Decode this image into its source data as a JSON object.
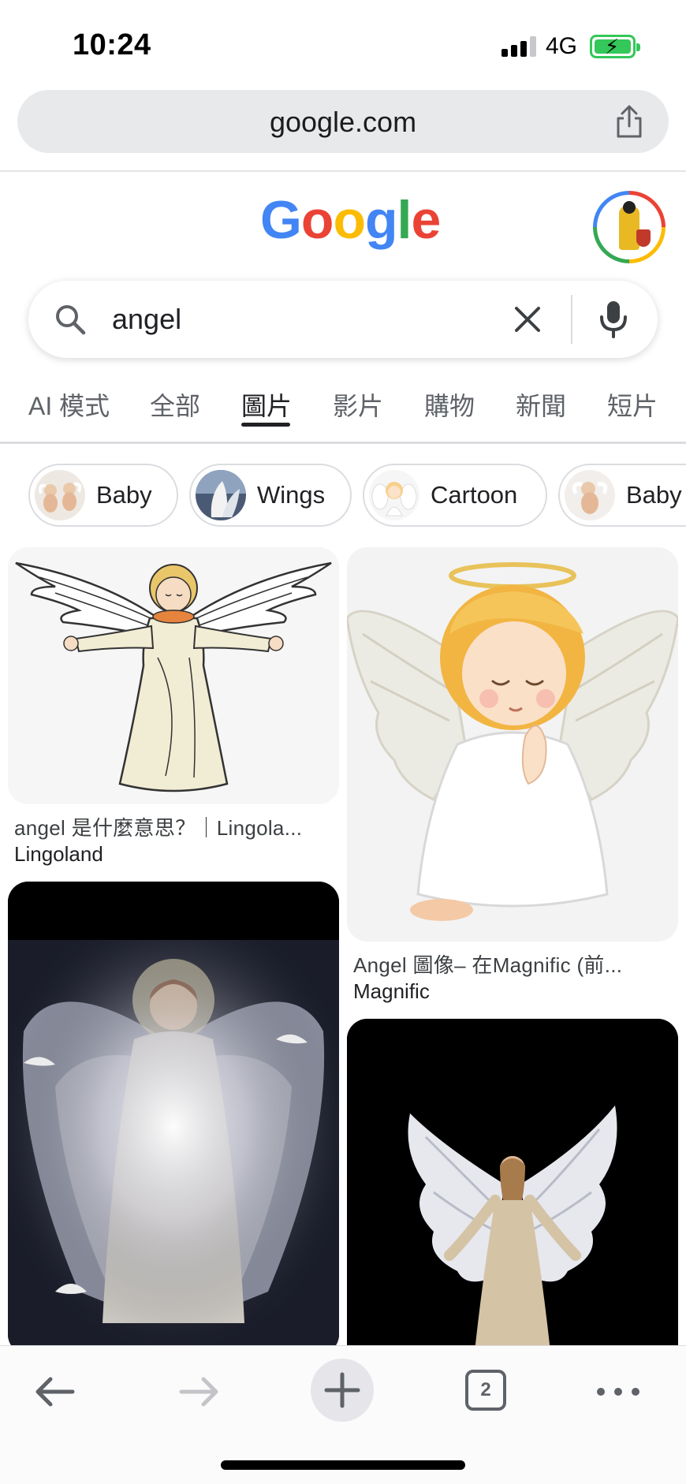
{
  "status_bar": {
    "time": "10:24",
    "network": "4G"
  },
  "browser": {
    "url": "google.com"
  },
  "google": {
    "logo_letters": [
      "G",
      "o",
      "o",
      "g",
      "l",
      "e"
    ],
    "search": {
      "query": "angel"
    },
    "tabs": [
      {
        "label": "AI 模式"
      },
      {
        "label": "全部"
      },
      {
        "label": "圖片",
        "active": true
      },
      {
        "label": "影片"
      },
      {
        "label": "購物"
      },
      {
        "label": "新聞"
      },
      {
        "label": "短片"
      }
    ],
    "chips": [
      {
        "label": "Baby"
      },
      {
        "label": "Wings"
      },
      {
        "label": "Cartoon"
      },
      {
        "label": "Baby"
      }
    ],
    "results": [
      {
        "title": "angel 是什麼意思？｜Lingola...",
        "source": "Lingoland"
      },
      {
        "title": "Angel 圖像– 在Magnific (前...",
        "source": "Magnific"
      },
      {
        "title": "",
        "source": ""
      },
      {
        "title": "",
        "source": ""
      }
    ]
  },
  "toolbar": {
    "tab_count": "2"
  },
  "colors": {
    "google_blue": "#4285F4",
    "google_red": "#EA4335",
    "google_yellow": "#FBBC05",
    "google_green": "#34A853",
    "battery_green": "#34c759"
  },
  "icons": [
    "share-icon",
    "search-icon",
    "clear-icon",
    "mic-icon",
    "back-arrow-icon",
    "forward-arrow-icon",
    "plus-icon",
    "more-icon"
  ]
}
